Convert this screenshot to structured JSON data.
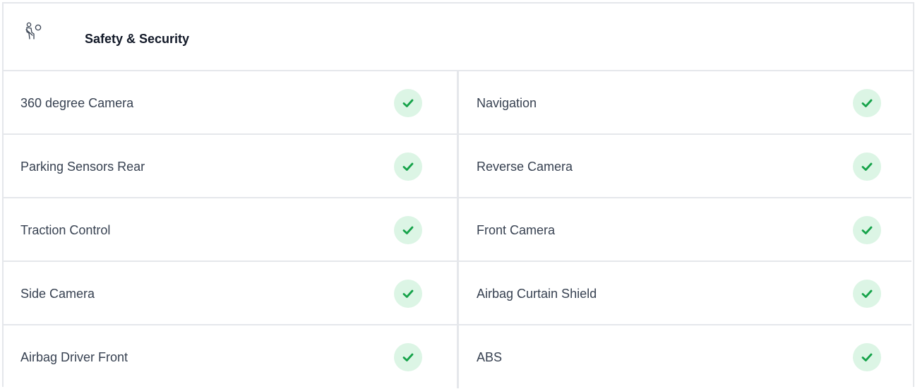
{
  "section": {
    "title": "Safety & Security",
    "icon": "seatbelt-person-icon"
  },
  "colors": {
    "check_bg": "#dcf5e5",
    "check_mark": "#16a34a",
    "border": "#e5e7eb",
    "text": "#374151"
  },
  "features": {
    "left": [
      {
        "label": "360 degree Camera",
        "available": true
      },
      {
        "label": "Parking Sensors Rear",
        "available": true
      },
      {
        "label": "Traction Control",
        "available": true
      },
      {
        "label": "Side Camera",
        "available": true
      },
      {
        "label": "Airbag Driver Front",
        "available": true
      }
    ],
    "right": [
      {
        "label": "Navigation",
        "available": true
      },
      {
        "label": "Reverse Camera",
        "available": true
      },
      {
        "label": "Front Camera",
        "available": true
      },
      {
        "label": "Airbag Curtain Shield",
        "available": true
      },
      {
        "label": "ABS",
        "available": true
      }
    ]
  }
}
